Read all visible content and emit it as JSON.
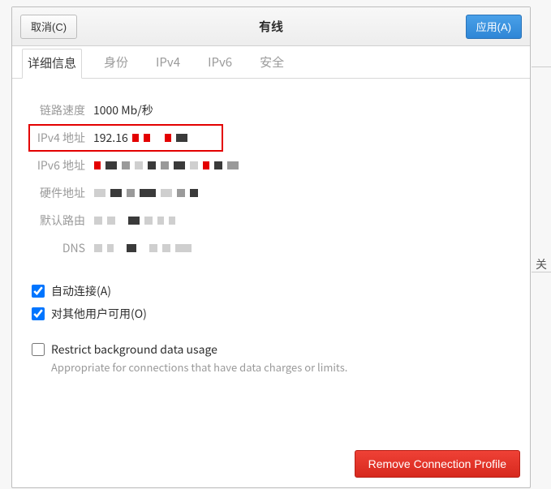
{
  "under": {
    "label_truncated": "关"
  },
  "titlebar": {
    "cancel": "取消(C)",
    "title": "有线",
    "apply": "应用(A)"
  },
  "tabs": [
    {
      "key": "details",
      "label": "详细信息",
      "active": true
    },
    {
      "key": "identity",
      "label": "身份",
      "active": false
    },
    {
      "key": "ipv4",
      "label": "IPv4",
      "active": false
    },
    {
      "key": "ipv6",
      "label": "IPv6",
      "active": false
    },
    {
      "key": "security",
      "label": "安全",
      "active": false
    }
  ],
  "details": {
    "link_speed_label": "链路速度",
    "link_speed_value": "1000 Mb/秒",
    "ipv4_label": "IPv4 地址",
    "ipv4_value_visible": "192.16",
    "ipv6_label": "IPv6 地址",
    "hw_label": "硬件地址",
    "route_label": "默认路由",
    "dns_label": "DNS"
  },
  "checks": {
    "auto_connect": "自动连接(A)",
    "auto_connect_checked": true,
    "other_users": "对其他用户可用(O)",
    "other_users_checked": true,
    "restrict_bg": "Restrict background data usage",
    "restrict_bg_sub": "Appropriate for connections that have data charges or limits.",
    "restrict_bg_checked": false
  },
  "footer": {
    "remove": "Remove Connection Profile"
  }
}
